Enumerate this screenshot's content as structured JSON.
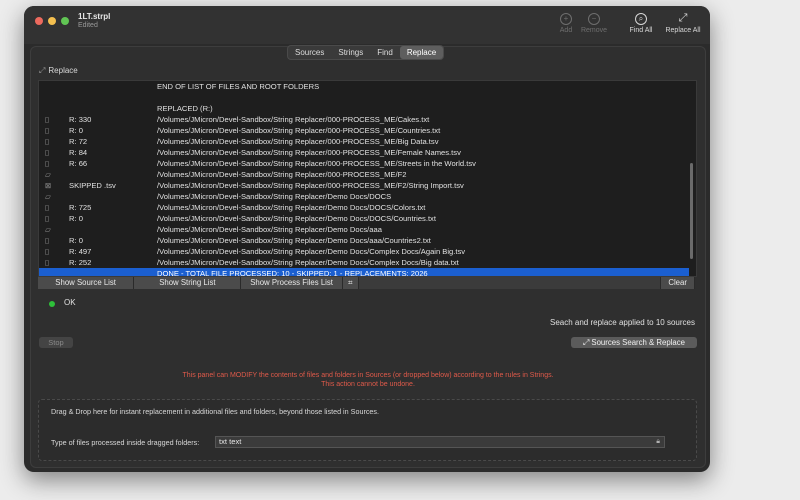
{
  "window": {
    "title": "1LT.strpl",
    "subtitle": "Edited"
  },
  "toolbar": [
    {
      "name": "add",
      "label": "Add",
      "icon": "plus-circle-icon",
      "glyph": "+",
      "enabled": false
    },
    {
      "name": "remove",
      "label": "Remove",
      "icon": "minus-circle-icon",
      "glyph": "−",
      "enabled": false
    },
    {
      "name": "find-all",
      "label": "Find All",
      "icon": "magnifier-icon",
      "glyph": "⌕",
      "enabled": true
    },
    {
      "name": "replace-all",
      "label": "Replace All",
      "icon": "replace-arrows-icon",
      "glyph": "⤢",
      "enabled": true
    }
  ],
  "tabs": [
    {
      "label": "Sources",
      "active": false
    },
    {
      "label": "Strings",
      "active": false
    },
    {
      "label": "Find",
      "active": false
    },
    {
      "label": "Replace",
      "active": true
    }
  ],
  "panel": {
    "label": "Replace"
  },
  "log_rows": [
    {
      "icon": "",
      "status": "",
      "path": "END OF LIST OF FILES AND ROOT FOLDERS"
    },
    {
      "icon": "",
      "status": "",
      "path": ""
    },
    {
      "icon": "",
      "status": "",
      "path": "REPLACED (R:)"
    },
    {
      "icon": "file-icon",
      "status": "R: 330",
      "path": "/Volumes/JMicron/Devel-Sandbox/String Replacer/000-PROCESS_ME/Cakes.txt"
    },
    {
      "icon": "file-icon",
      "status": "R: 0",
      "path": "/Volumes/JMicron/Devel-Sandbox/String Replacer/000-PROCESS_ME/Countries.txt"
    },
    {
      "icon": "file-icon",
      "status": "R: 72",
      "path": "/Volumes/JMicron/Devel-Sandbox/String Replacer/000-PROCESS_ME/Big Data.tsv"
    },
    {
      "icon": "file-icon",
      "status": "R: 84",
      "path": "/Volumes/JMicron/Devel-Sandbox/String Replacer/000-PROCESS_ME/Female Names.tsv"
    },
    {
      "icon": "file-icon",
      "status": "R: 66",
      "path": "/Volumes/JMicron/Devel-Sandbox/String Replacer/000-PROCESS_ME/Streets in the World.tsv"
    },
    {
      "icon": "folder-open-icon",
      "status": "",
      "path": "/Volumes/JMicron/Devel-Sandbox/String Replacer/000-PROCESS_ME/F2"
    },
    {
      "icon": "skipped-file-icon",
      "status": "SKIPPED .tsv",
      "path": "/Volumes/JMicron/Devel-Sandbox/String Replacer/000-PROCESS_ME/F2/String Import.tsv"
    },
    {
      "icon": "folder-open-icon",
      "status": "",
      "path": "/Volumes/JMicron/Devel-Sandbox/String Replacer/Demo Docs/DOCS"
    },
    {
      "icon": "file-icon",
      "status": "R: 725",
      "path": "/Volumes/JMicron/Devel-Sandbox/String Replacer/Demo Docs/DOCS/Colors.txt"
    },
    {
      "icon": "file-icon",
      "status": "R: 0",
      "path": "/Volumes/JMicron/Devel-Sandbox/String Replacer/Demo Docs/DOCS/Countries.txt"
    },
    {
      "icon": "folder-open-icon",
      "status": "",
      "path": "/Volumes/JMicron/Devel-Sandbox/String Replacer/Demo Docs/aaa"
    },
    {
      "icon": "file-icon",
      "status": "R: 0",
      "path": "/Volumes/JMicron/Devel-Sandbox/String Replacer/Demo Docs/aaa/Countries2.txt"
    },
    {
      "icon": "file-icon",
      "status": "R: 497",
      "path": "/Volumes/JMicron/Devel-Sandbox/String Replacer/Demo Docs/Complex Docs/Again Big.tsv"
    },
    {
      "icon": "file-icon",
      "status": "R: 252",
      "path": "/Volumes/JMicron/Devel-Sandbox/String Replacer/Demo Docs/Complex Docs/Big data.txt"
    },
    {
      "icon": "",
      "status": "",
      "path": "DONE - TOTAL FILE PROCESSED: 10 - SKIPPED: 1 - REPLACEMENTS: 2026",
      "selected": true
    }
  ],
  "log_buttons": {
    "show_sources": "Show Source List",
    "show_strings": "Show String List",
    "show_process": "Show Process Files List",
    "clear": "Clear"
  },
  "status": {
    "text": "OK",
    "color": "#2ec03a"
  },
  "summary": "Seach and replace applied to  10 sources",
  "actions": {
    "stop": "Stop",
    "search_replace": "Sources Search & Replace"
  },
  "warning": {
    "line1": "This panel can MODIFY the contents of files and folders in Sources (or dropped below) according to the rules in Strings.",
    "line2": "This action cannot be undone.",
    "color": "#e05a4a"
  },
  "dropzone": {
    "title": "Drag & Drop here for instant replacement in additional files and folders, beyond those listed in Sources.",
    "types_label": "Type of files processed inside dragged folders:",
    "types_value": "txt text"
  },
  "colors": {
    "selection": "#1b5fd0",
    "window_bg": "#2b2b2b"
  }
}
